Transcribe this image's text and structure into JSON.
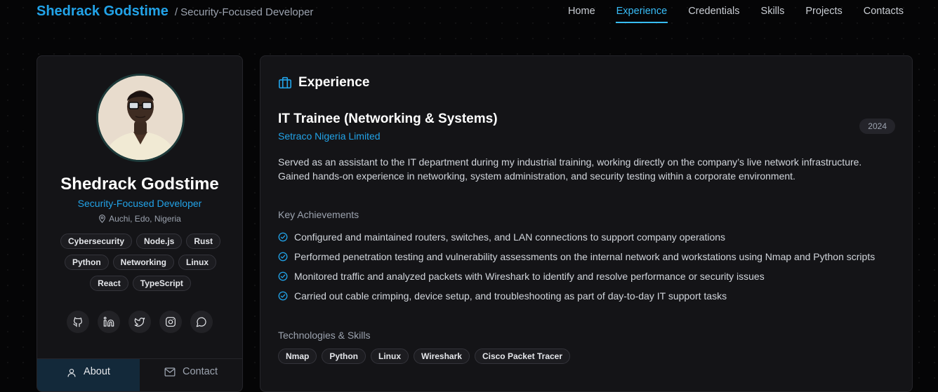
{
  "header": {
    "brand_name": "Shedrack Godstime",
    "brand_role": "/ Security-Focused Developer",
    "nav": [
      "Home",
      "Experience",
      "Credentials",
      "Skills",
      "Projects",
      "Contacts"
    ],
    "active_nav": "Experience"
  },
  "profile": {
    "name": "Shedrack Godstime",
    "role": "Security-Focused Developer",
    "location": "Auchi, Edo, Nigeria",
    "tags": [
      "Cybersecurity",
      "Node.js",
      "Rust",
      "Python",
      "Networking",
      "Linux",
      "React",
      "TypeScript"
    ],
    "socials": [
      "github-icon",
      "linkedin-icon",
      "twitter-icon",
      "instagram-icon",
      "whatsapp-icon"
    ],
    "tabs": {
      "about": "About",
      "contact": "Contact"
    }
  },
  "experience": {
    "section_title": "Experience",
    "job_title": "IT Trainee (Networking & Systems)",
    "company": "Setraco Nigeria Limited",
    "year": "2024",
    "description": "Served as an assistant to the IT department during my industrial training, working directly on the company’s live network infrastructure. Gained hands-on experience in networking, system administration, and security testing within a corporate environment.",
    "achievements_heading": "Key Achievements",
    "achievements": [
      "Configured and maintained routers, switches, and LAN connections to support company operations",
      "Performed penetration testing and vulnerability assessments on the internal network and workstations using Nmap and Python scripts",
      "Monitored traffic and analyzed packets with Wireshark to identify and resolve performance or security issues",
      "Carried out cable crimping, device setup, and troubleshooting as part of day-to-day IT support tasks"
    ],
    "tech_heading": "Technologies & Skills",
    "technologies": [
      "Nmap",
      "Python",
      "Linux",
      "Wireshark",
      "Cisco Packet Tracer"
    ]
  },
  "colors": {
    "accent": "#22a3e8",
    "active_tab": "#13293a",
    "background": "#050506",
    "card": "#141417"
  }
}
